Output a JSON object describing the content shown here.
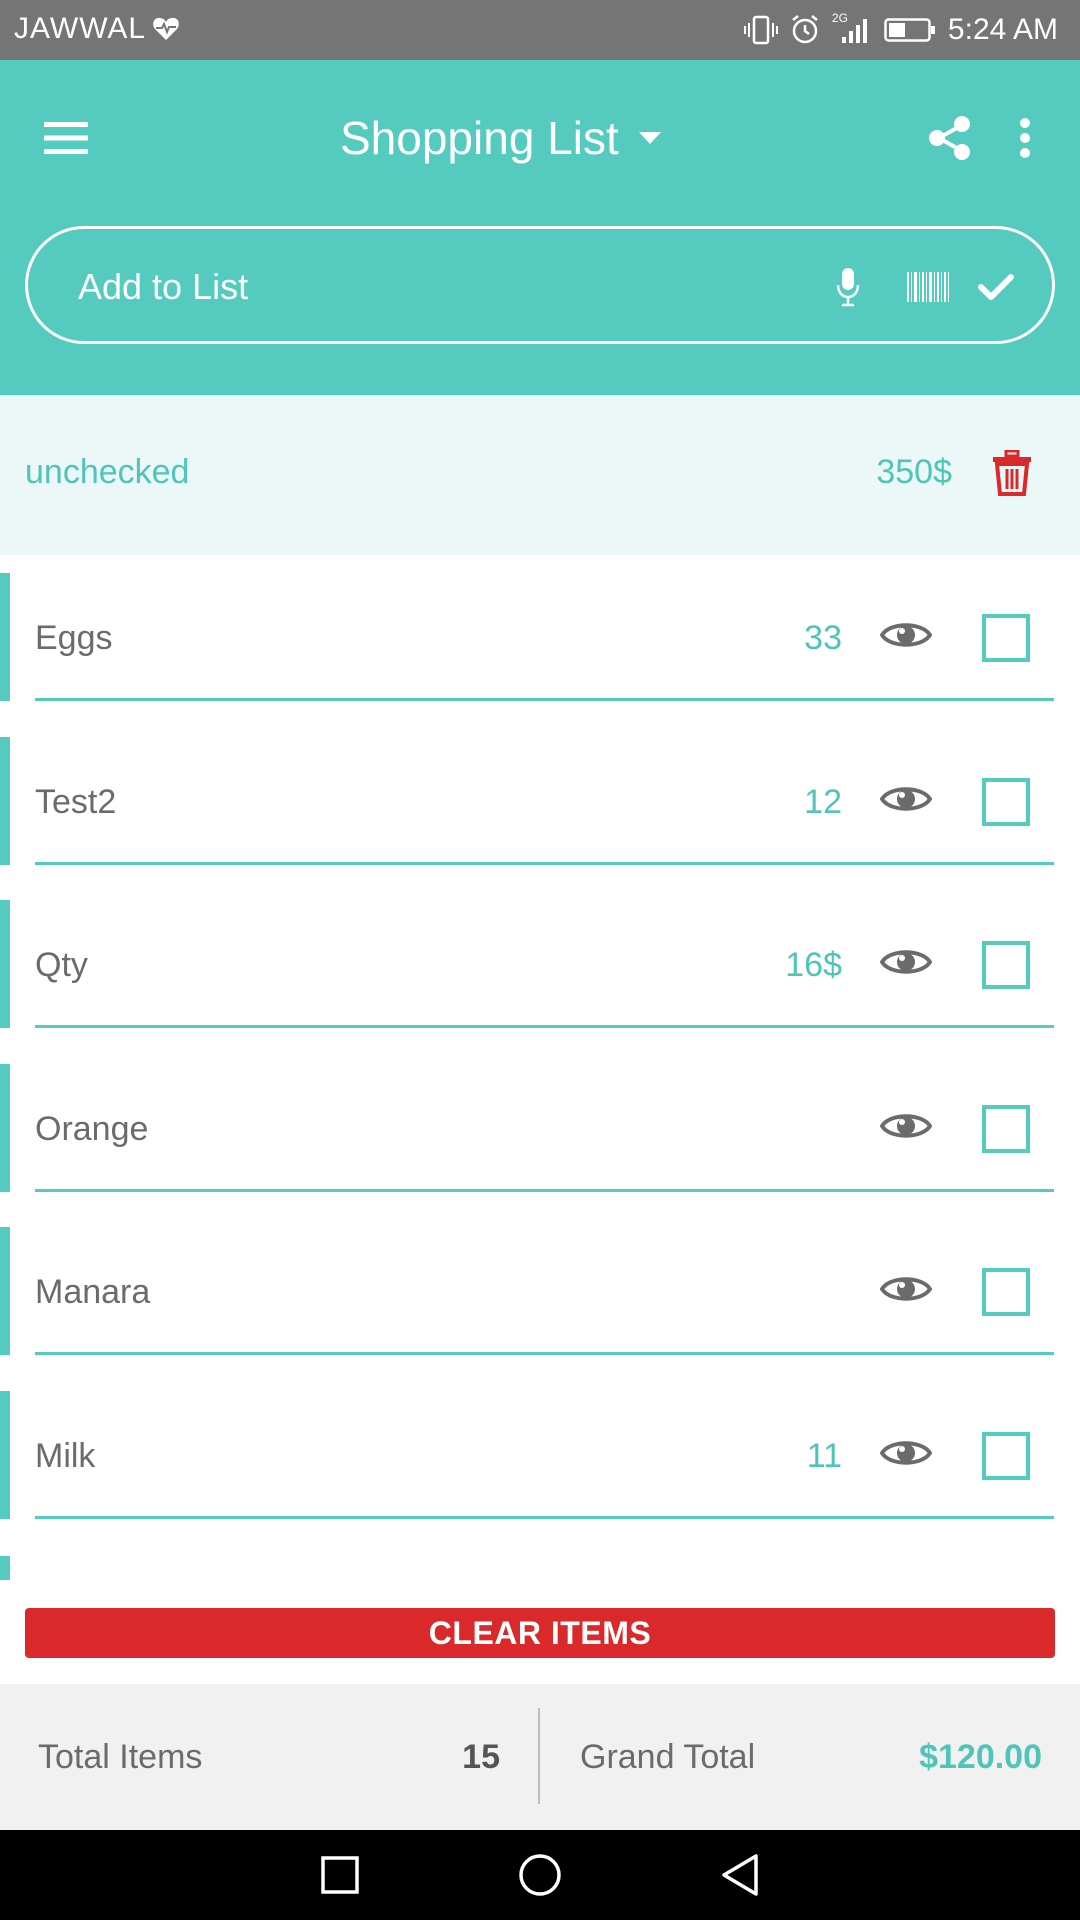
{
  "status_bar": {
    "carrier": "JAWWAL",
    "network": "2G",
    "time": "5:24 AM"
  },
  "header": {
    "title": "Shopping List",
    "add_placeholder": "Add to List",
    "icons": [
      "menu-icon",
      "chevron-down-icon",
      "share-icon",
      "more-vert-icon",
      "mic-icon",
      "barcode-icon",
      "check-icon"
    ]
  },
  "section": {
    "label": "unchecked",
    "total": "350$"
  },
  "items": [
    {
      "name": "Eggs",
      "qty": "33",
      "checked": false
    },
    {
      "name": "Test2",
      "qty": "12",
      "checked": false
    },
    {
      "name": "Qty",
      "qty": "16$",
      "checked": false
    },
    {
      "name": "Orange",
      "qty": "",
      "checked": false
    },
    {
      "name": "Manara",
      "qty": "",
      "checked": false
    },
    {
      "name": "Milk",
      "qty": "11",
      "checked": false
    }
  ],
  "actions": {
    "clear_label": "CLEAR ITEMS"
  },
  "footer": {
    "total_items_label": "Total Items",
    "total_items_value": "15",
    "grand_total_label": "Grand Total",
    "grand_total_value": "$120.00"
  },
  "colors": {
    "primary": "#55CBBF",
    "accent_text": "#4FC4B8",
    "danger": "#D9292B",
    "section_bg": "#ECF8F7",
    "footer_bg": "#F1F1F1"
  }
}
